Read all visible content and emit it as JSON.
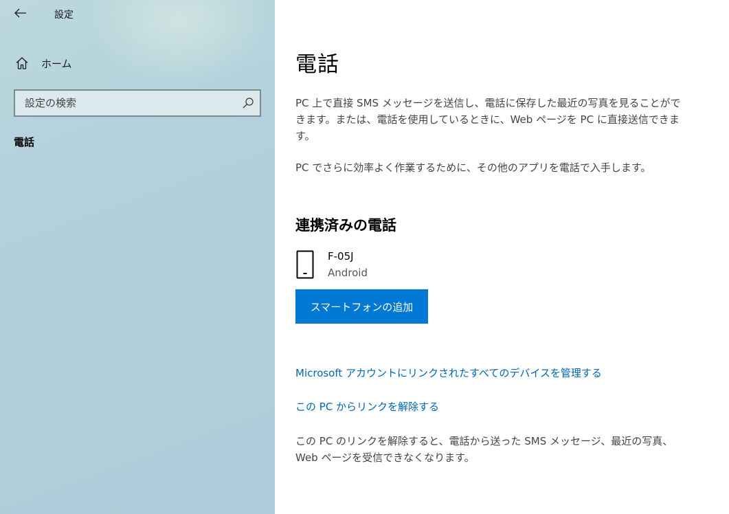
{
  "window": {
    "app_title": "設定"
  },
  "sidebar": {
    "home_label": "ホーム",
    "search_placeholder": "設定の検索",
    "current_item": "電話"
  },
  "main": {
    "title": "電話",
    "description": "PC 上で直接 SMS メッセージを送信し、電話に保存した最近の写真を見ることができます。または、電話を使用しているときに、Web ページを PC に直接送信できます。",
    "more_apps_text": "PC でさらに効率よく作業するために、その他のアプリを電話で入手します。",
    "linked_section_title": "連携済みの電話",
    "device": {
      "name": "F-05J",
      "os": "Android"
    },
    "add_button_label": "スマートフォンの追加",
    "manage_link": "Microsoft アカウントにリンクされたすべてのデバイスを管理する",
    "unlink_link": "この PC からリンクを解除する",
    "unlink_description": "この PC のリンクを解除すると、電話から送った SMS メッセージ、最近の写真、Web ページを受信できなくなります。"
  },
  "icons": {
    "back": "back-arrow-icon",
    "home": "home-icon",
    "search": "search-icon",
    "phone": "phone-icon"
  },
  "colors": {
    "accent": "#0078d4",
    "link": "#0066b4",
    "sidebar_bg": "#b3d1dc"
  }
}
